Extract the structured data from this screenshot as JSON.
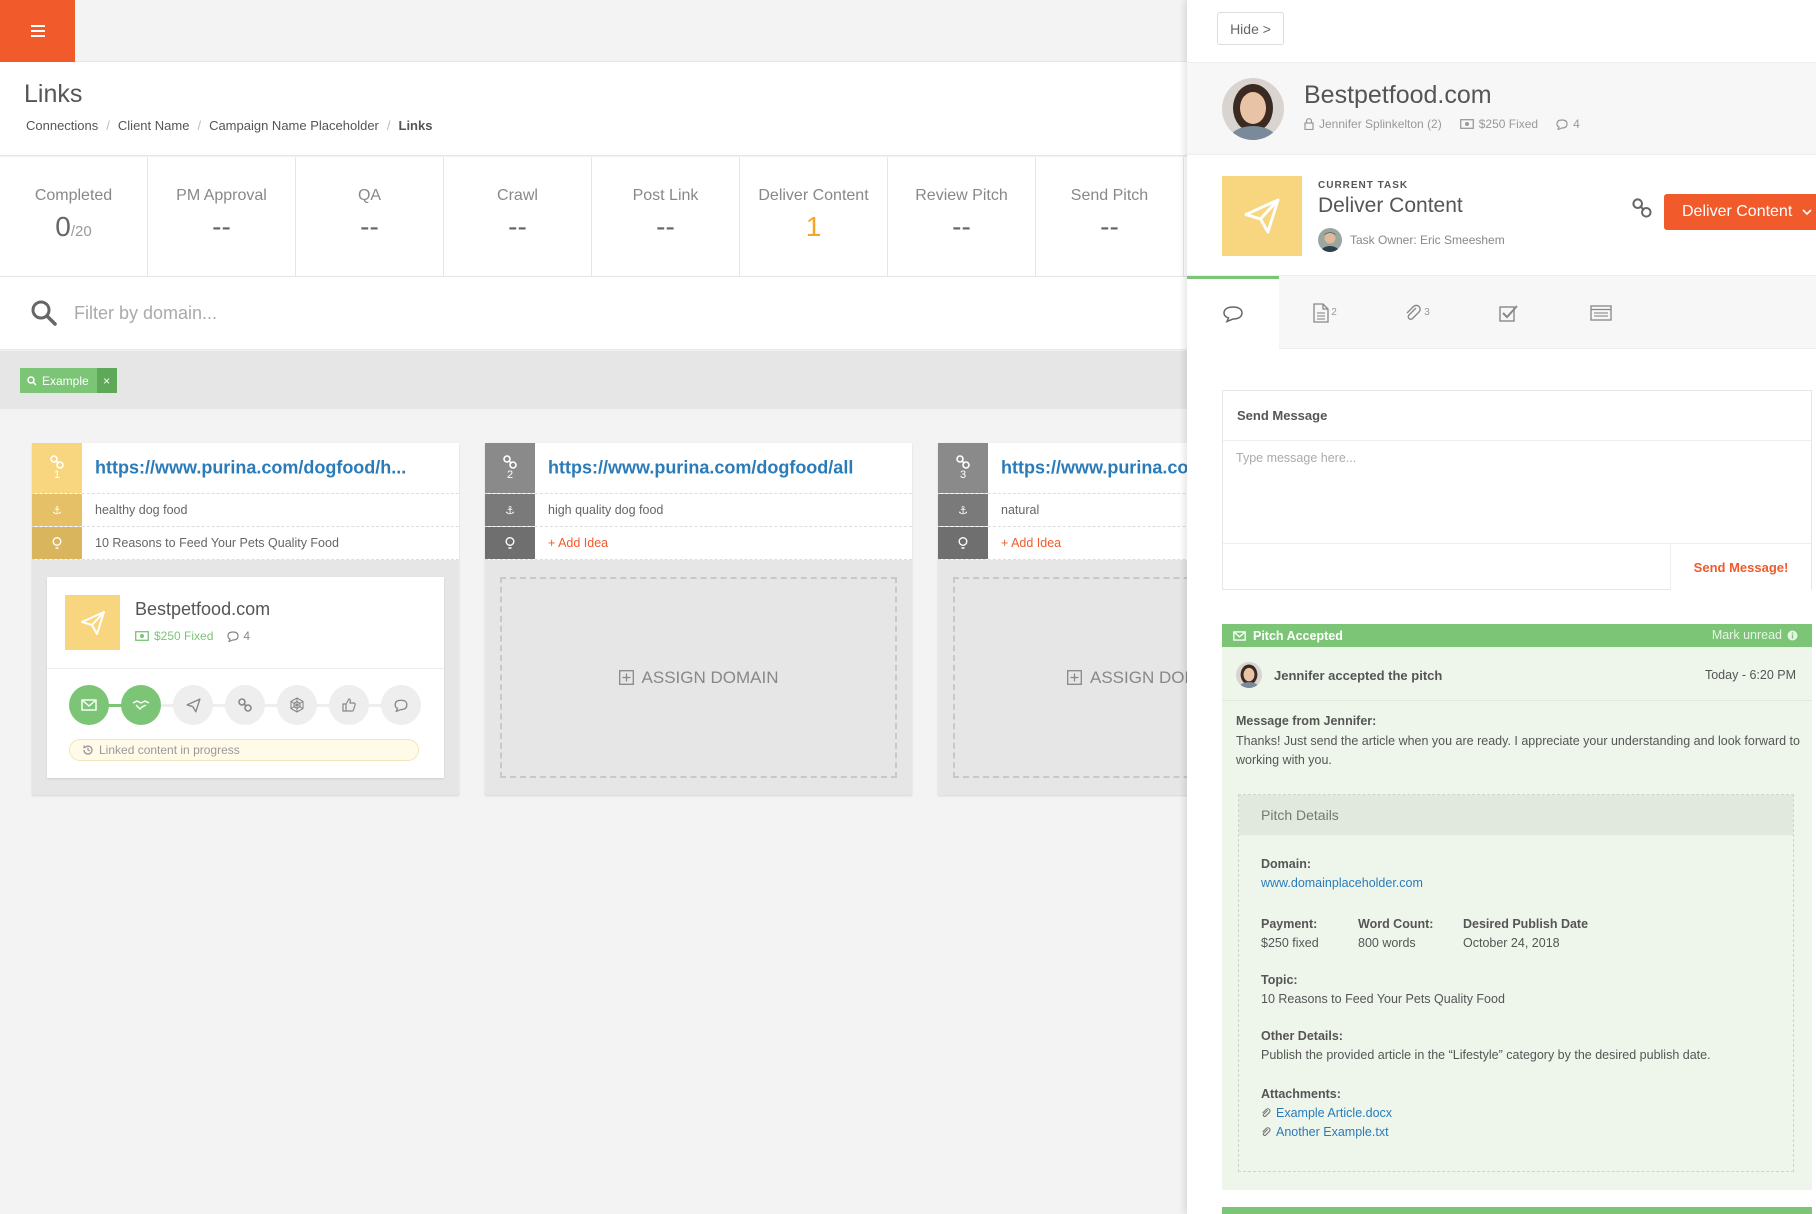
{
  "header": {
    "title": "Links",
    "breadcrumb": [
      "Connections",
      "Client Name",
      "Campaign Name Placeholder",
      "Links"
    ]
  },
  "stats": [
    {
      "label": "Completed",
      "value": "0",
      "suffix": "/20",
      "accent": false
    },
    {
      "label": "PM Approval",
      "value": "--",
      "suffix": "",
      "accent": false
    },
    {
      "label": "QA",
      "value": "--",
      "suffix": "",
      "accent": false
    },
    {
      "label": "Crawl",
      "value": "--",
      "suffix": "",
      "accent": false
    },
    {
      "label": "Post Link",
      "value": "--",
      "suffix": "",
      "accent": false
    },
    {
      "label": "Deliver Content",
      "value": "1",
      "suffix": "",
      "accent": true
    },
    {
      "label": "Review Pitch",
      "value": "--",
      "suffix": "",
      "accent": false
    },
    {
      "label": "Send Pitch",
      "value": "--",
      "suffix": "",
      "accent": false
    }
  ],
  "search": {
    "placeholder": "Filter by domain..."
  },
  "filter_tag": {
    "label": "Example",
    "remove": "×"
  },
  "cards": [
    {
      "num": "1",
      "url": "https://www.purina.com/dogfood/h...",
      "anchor": "healthy dog food",
      "idea": "10 Reasons to Feed Your Pets Quality Food",
      "idea_is_add": false
    },
    {
      "num": "2",
      "url": "https://www.purina.com/dogfood/all",
      "anchor": "high quality dog food",
      "idea": "+ Add Idea",
      "idea_is_add": true
    },
    {
      "num": "3",
      "url": "https://www.purina.co",
      "anchor": "natural",
      "idea": "+ Add Idea",
      "idea_is_add": true
    }
  ],
  "domain_card": {
    "name": "Bestpetfood.com",
    "price": "$250 Fixed",
    "comments": "4",
    "progress": "Linked content in progress"
  },
  "assign_label": "ASSIGN DOMAIN",
  "assign_label_cut": "ASSIGN DOM",
  "panel": {
    "hide": "Hide >",
    "domain": "Bestpetfood.com",
    "contact": "Jennifer Splinkelton (2)",
    "price": "$250 Fixed",
    "comments": "4",
    "task_label": "CURRENT TASK",
    "task_name": "Deliver Content",
    "task_owner": "Task Owner: Eric Smeeshem",
    "action_button": "Deliver Content",
    "tabs": [
      {
        "icon": "chat-icon",
        "count": ""
      },
      {
        "icon": "document-icon",
        "count": "2"
      },
      {
        "icon": "paperclip-icon",
        "count": "3"
      },
      {
        "icon": "checkbox-icon",
        "count": ""
      },
      {
        "icon": "list-icon",
        "count": ""
      }
    ],
    "send_message": {
      "title": "Send Message",
      "placeholder": "Type message here...",
      "button": "Send Message!"
    },
    "notice": {
      "title": "Pitch Accepted",
      "mark": "Mark unread",
      "who": "Jennifer accepted the pitch",
      "time": "Today - 6:20 PM",
      "from": "Message from Jennifer:",
      "text": "Thanks! Just send the article when you are ready. I appreciate your understanding and look forward to working with you."
    },
    "pitch": {
      "title": "Pitch Details",
      "domain_label": "Domain:",
      "domain": "www.domainplaceholder.com",
      "payment_label": "Payment:",
      "payment": "$250 fixed",
      "wordcount_label": "Word Count:",
      "wordcount": "800 words",
      "date_label": "Desired Publish Date",
      "date": "October 24, 2018",
      "topic_label": "Topic:",
      "topic": "10 Reasons to Feed Your Pets Quality Food",
      "other_label": "Other Details:",
      "other": "Publish the provided article in the “Lifestyle” category by the desired publish date.",
      "attach_label": "Attachments:",
      "attachments": [
        "Example Article.docx",
        "Another Example.txt"
      ]
    }
  },
  "colors": {
    "accent": "#f15a2b",
    "green": "#7cc576",
    "yellow": "#f8d57f",
    "link": "#2b7bb9"
  }
}
